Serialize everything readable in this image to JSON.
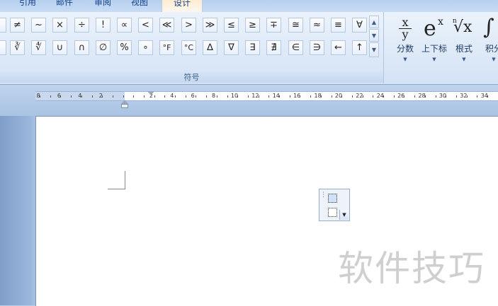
{
  "tabs": [
    {
      "label": "引用",
      "active": false
    },
    {
      "label": "邮件",
      "active": false
    },
    {
      "label": "审阅",
      "active": false
    },
    {
      "label": "视图",
      "active": false
    },
    {
      "label": "设计",
      "active": true
    }
  ],
  "symbols_group": {
    "label": "符号",
    "row1": [
      "≠",
      "~",
      "×",
      "÷",
      "!",
      "∝",
      "<",
      "≪",
      ">",
      "≫",
      "≤",
      "≥",
      "∓",
      "≅",
      "≈",
      "≡",
      "∀"
    ],
    "row2": [
      "∛",
      "∜",
      "∪",
      "∩",
      "∅",
      "%",
      "∘",
      "°F",
      "°C",
      "∆",
      "∇",
      "∃",
      "∄",
      "∈",
      "∋",
      "←",
      "↑"
    ],
    "scroll_up": "▲",
    "scroll_down": "▼",
    "scroll_more": "▼"
  },
  "structures_group": {
    "buttons": [
      {
        "label": "分数",
        "icon": "fraction-icon",
        "glyph_top": "x",
        "glyph_bottom": "y"
      },
      {
        "label": "上下标",
        "icon": "superscript-icon",
        "glyph_base": "e",
        "glyph_sup": "x"
      },
      {
        "label": "根式",
        "icon": "radical-icon",
        "glyph_index": "n",
        "glyph_root": "√x"
      },
      {
        "label": "积分",
        "icon": "integral-icon",
        "glyph": "∫"
      }
    ],
    "dropdown_arrow": "▼"
  },
  "ruler": {
    "left_ticks": [
      "8",
      "6",
      "4",
      "2"
    ],
    "right_ticks": [
      "2",
      "4",
      "6",
      "8",
      "10",
      "12",
      "14",
      "16",
      "18",
      "20",
      "22",
      "24",
      "26",
      "28",
      "30",
      "32",
      "34"
    ]
  },
  "equation_placeholder": {
    "handle": "⋮",
    "dropdown": "▼"
  },
  "watermark": "软件技巧"
}
